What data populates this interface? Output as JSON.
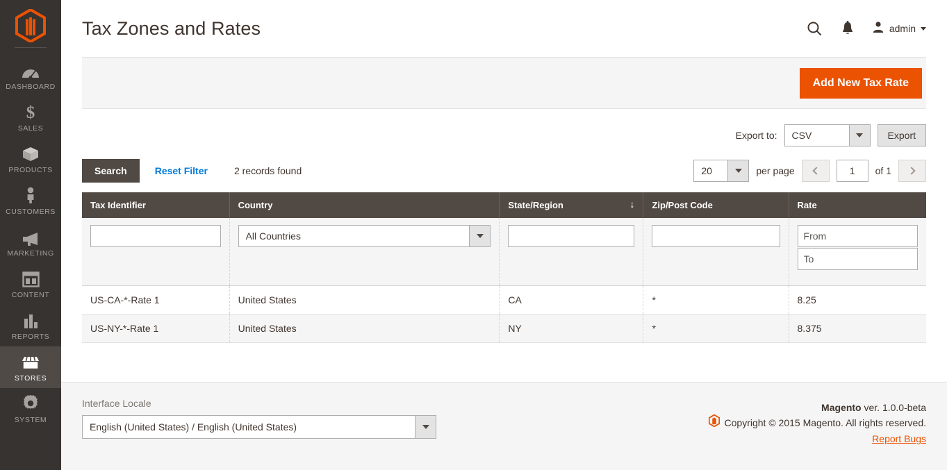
{
  "sidebar": {
    "logo": "magento-logo",
    "items": [
      {
        "label": "DASHBOARD",
        "icon": "dashboard-icon",
        "active": false
      },
      {
        "label": "SALES",
        "icon": "dollar-icon",
        "active": false
      },
      {
        "label": "PRODUCTS",
        "icon": "box-icon",
        "active": false
      },
      {
        "label": "CUSTOMERS",
        "icon": "person-icon",
        "active": false
      },
      {
        "label": "MARKETING",
        "icon": "megaphone-icon",
        "active": false
      },
      {
        "label": "CONTENT",
        "icon": "layout-icon",
        "active": false
      },
      {
        "label": "REPORTS",
        "icon": "bar-chart-icon",
        "active": false
      },
      {
        "label": "STORES",
        "icon": "storefront-icon",
        "active": true
      },
      {
        "label": "SYSTEM",
        "icon": "gear-icon",
        "active": false
      }
    ]
  },
  "header": {
    "title": "Tax Zones and Rates",
    "search_icon": "search-icon",
    "notifications_icon": "bell-icon",
    "admin_icon": "user-avatar-icon",
    "admin_name": "admin"
  },
  "page_actions": {
    "add_label": "Add New Tax Rate"
  },
  "export": {
    "label": "Export to:",
    "format": "CSV",
    "button": "Export"
  },
  "toolbar": {
    "search_label": "Search",
    "reset_label": "Reset Filter",
    "records_found": "2 records found",
    "per_page_value": "20",
    "per_page_label": "per page",
    "page_value": "1",
    "of_label": "of 1"
  },
  "grid": {
    "columns": [
      {
        "label": "Tax Identifier",
        "sorted": false
      },
      {
        "label": "Country",
        "sorted": false
      },
      {
        "label": "State/Region",
        "sorted": true,
        "sort_direction": "↓"
      },
      {
        "label": "Zip/Post Code",
        "sorted": false
      },
      {
        "label": "Rate",
        "sorted": false
      }
    ],
    "filters": {
      "tax_identifier": "",
      "country": "All Countries",
      "state_region": "",
      "zip_post_code": "",
      "rate_from_placeholder": "From",
      "rate_to_placeholder": "To",
      "rate_from": "",
      "rate_to": ""
    },
    "rows": [
      {
        "tax_identifier": "US-CA-*-Rate 1",
        "country": "United States",
        "state_region": "CA",
        "zip_post_code": "*",
        "rate": "8.25"
      },
      {
        "tax_identifier": "US-NY-*-Rate 1",
        "country": "United States",
        "state_region": "NY",
        "zip_post_code": "*",
        "rate": "8.375"
      }
    ]
  },
  "footer": {
    "locale_label": "Interface Locale",
    "locale_value": "English (United States) / English (United States)",
    "brand": "Magento",
    "version": " ver. 1.0.0-beta",
    "copyright": "Copyright © 2015 Magento. All rights reserved.",
    "report_bugs": "Report Bugs"
  },
  "colors": {
    "accent": "#eb5202",
    "sidebar_bg": "#373330",
    "sidebar_active": "#4f4a46",
    "header_dark": "#514943",
    "link_blue": "#007bdb"
  }
}
